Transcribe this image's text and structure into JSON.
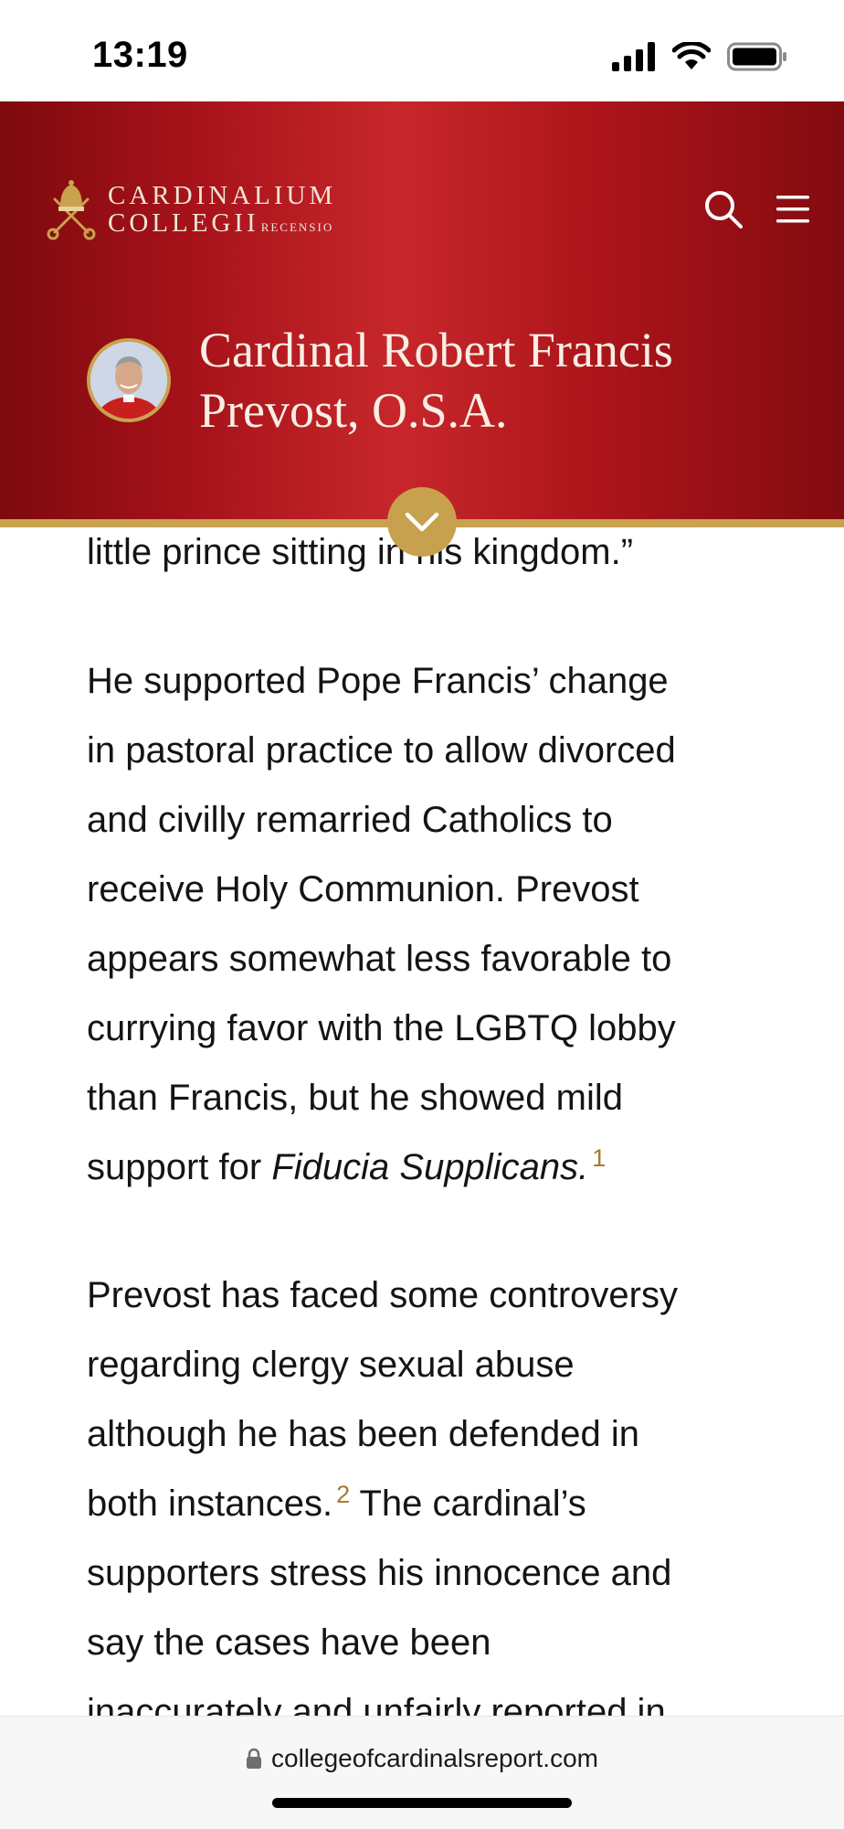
{
  "status_bar": {
    "time": "13:19"
  },
  "header": {
    "logo": {
      "line1": "CARDINALIUM",
      "line2": "COLLEGII",
      "sub": "RECENSIO"
    },
    "title_line1": "Cardinal Robert Francis",
    "title_line2": "Prevost, O.S.A."
  },
  "article": {
    "line0": "little prince sitting in his kingdom.”",
    "p1": [
      "He supported Pope Francis’ change",
      "in pastoral practice to allow divorced",
      "and civilly remarried Catholics to",
      "receive Holy Communion. Prevost",
      "appears somewhat less favorable to",
      "currying favor with the LGBTQ lobby",
      "than Francis, but he showed mild"
    ],
    "p1_last_prefix": "support for ",
    "p1_last_italic": "Fiducia Supplicans.",
    "footnote1": "1",
    "p2": [
      "Prevost has faced some controversy",
      "regarding clergy sexual abuse",
      "although he has been defended in"
    ],
    "p2_l4_prefix": "both instances.",
    "footnote2": "2",
    "p2_l4_suffix": " The cardinal’s",
    "p2_rest": [
      "supporters stress his innocence and",
      "say the cases have been",
      "inaccurately and unfairly reported in"
    ]
  },
  "browser": {
    "url": "collegeofcardinalsreport.com"
  },
  "colors": {
    "header_red": "#c7272b",
    "gold": "#c8a14e",
    "footnote": "#a8792f"
  }
}
